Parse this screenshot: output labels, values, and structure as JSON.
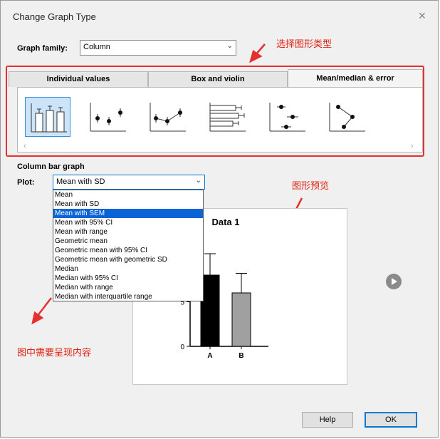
{
  "dialog": {
    "title": "Change Graph Type"
  },
  "graph_family": {
    "label": "Graph family:",
    "value": "Column"
  },
  "annotations": {
    "family": "选择图形类型",
    "preview": "图形预览",
    "content": "图中需要呈现内容"
  },
  "tabs": [
    {
      "label": "Individual values",
      "active": false
    },
    {
      "label": "Box and violin",
      "active": false
    },
    {
      "label": "Mean/median & error",
      "active": true
    }
  ],
  "gallery": {
    "items": [
      "column-bar-graph-icon",
      "mean-error-dots-icon",
      "connected-mean-error-icon",
      "horizontal-bar-error-icon",
      "spread-points-error-icon",
      "connected-spread-error-icon"
    ],
    "scroll_left": "‹",
    "scroll_right": "›"
  },
  "section_title": "Column bar graph",
  "plot": {
    "label": "Plot:",
    "value": "Mean with SD",
    "options": [
      "Mean",
      "Mean with SD",
      "Mean with SEM",
      "Mean with 95% CI",
      "Mean with range",
      "Geometric mean",
      "Geometric mean with 95% CI",
      "Geometric mean with geometric SD",
      "Median",
      "Median with 95% CI",
      "Median with range",
      "Median with interquartile range"
    ],
    "selected_index": 2
  },
  "chart_data": {
    "type": "bar",
    "title": "Data 1",
    "categories": [
      "A",
      "B"
    ],
    "values": [
      8,
      6
    ],
    "errors": [
      2.4,
      2.2
    ],
    "yticks": [
      0,
      5
    ],
    "ylim": [
      0,
      12
    ],
    "colors": [
      "#000000",
      "#a0a0a0"
    ]
  },
  "buttons": {
    "help": "Help",
    "ok": "OK"
  }
}
